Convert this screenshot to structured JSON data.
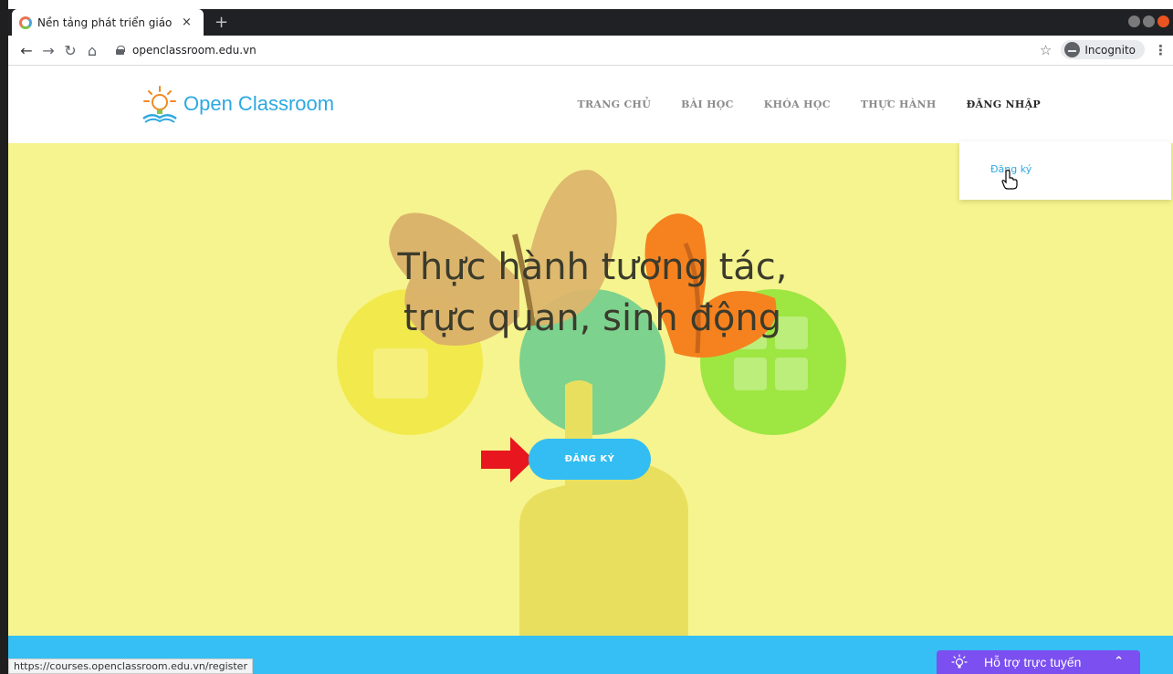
{
  "browser": {
    "tab_title": "Nền tảng phát triển giáo",
    "tab_close": "×",
    "new_tab": "+",
    "url": "openclassroom.edu.vn",
    "incognito_label": "Incognito",
    "status_url": "https://courses.openclassroom.edu.vn/register"
  },
  "site": {
    "logo_text": "Open Classroom",
    "nav": [
      {
        "label": "TRANG CHỦ"
      },
      {
        "label": "BÀI HỌC"
      },
      {
        "label": "KHÓA HỌC"
      },
      {
        "label": "THỰC HÀNH"
      },
      {
        "label": "ĐĂNG NHẬP"
      }
    ],
    "dropdown_item": "Đăng ký"
  },
  "hero": {
    "title_line1": "Thực hành tương tác,",
    "title_line2": "trực quan, sinh động",
    "cta_label": "ĐĂNG KÝ"
  },
  "support": {
    "label": "Hỗ trợ trực tuyến"
  },
  "colors": {
    "brand": "#2da9e1",
    "hero_bg": "#f6f48e",
    "cta": "#33bdf2",
    "support": "#7b4ff0"
  }
}
